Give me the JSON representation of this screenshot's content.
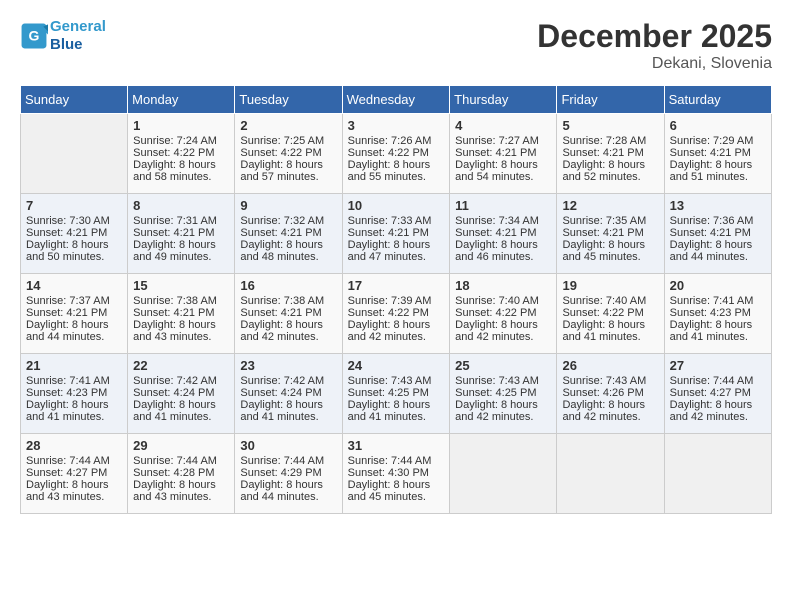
{
  "header": {
    "logo_line1": "General",
    "logo_line2": "Blue",
    "month": "December 2025",
    "location": "Dekani, Slovenia"
  },
  "weekdays": [
    "Sunday",
    "Monday",
    "Tuesday",
    "Wednesday",
    "Thursday",
    "Friday",
    "Saturday"
  ],
  "weeks": [
    [
      {
        "day": "",
        "empty": true,
        "lines": []
      },
      {
        "day": "1",
        "lines": [
          "Sunrise: 7:24 AM",
          "Sunset: 4:22 PM",
          "Daylight: 8 hours",
          "and 58 minutes."
        ]
      },
      {
        "day": "2",
        "lines": [
          "Sunrise: 7:25 AM",
          "Sunset: 4:22 PM",
          "Daylight: 8 hours",
          "and 57 minutes."
        ]
      },
      {
        "day": "3",
        "lines": [
          "Sunrise: 7:26 AM",
          "Sunset: 4:22 PM",
          "Daylight: 8 hours",
          "and 55 minutes."
        ]
      },
      {
        "day": "4",
        "lines": [
          "Sunrise: 7:27 AM",
          "Sunset: 4:21 PM",
          "Daylight: 8 hours",
          "and 54 minutes."
        ]
      },
      {
        "day": "5",
        "lines": [
          "Sunrise: 7:28 AM",
          "Sunset: 4:21 PM",
          "Daylight: 8 hours",
          "and 52 minutes."
        ]
      },
      {
        "day": "6",
        "lines": [
          "Sunrise: 7:29 AM",
          "Sunset: 4:21 PM",
          "Daylight: 8 hours",
          "and 51 minutes."
        ]
      }
    ],
    [
      {
        "day": "7",
        "lines": [
          "Sunrise: 7:30 AM",
          "Sunset: 4:21 PM",
          "Daylight: 8 hours",
          "and 50 minutes."
        ]
      },
      {
        "day": "8",
        "lines": [
          "Sunrise: 7:31 AM",
          "Sunset: 4:21 PM",
          "Daylight: 8 hours",
          "and 49 minutes."
        ]
      },
      {
        "day": "9",
        "lines": [
          "Sunrise: 7:32 AM",
          "Sunset: 4:21 PM",
          "Daylight: 8 hours",
          "and 48 minutes."
        ]
      },
      {
        "day": "10",
        "lines": [
          "Sunrise: 7:33 AM",
          "Sunset: 4:21 PM",
          "Daylight: 8 hours",
          "and 47 minutes."
        ]
      },
      {
        "day": "11",
        "lines": [
          "Sunrise: 7:34 AM",
          "Sunset: 4:21 PM",
          "Daylight: 8 hours",
          "and 46 minutes."
        ]
      },
      {
        "day": "12",
        "lines": [
          "Sunrise: 7:35 AM",
          "Sunset: 4:21 PM",
          "Daylight: 8 hours",
          "and 45 minutes."
        ]
      },
      {
        "day": "13",
        "lines": [
          "Sunrise: 7:36 AM",
          "Sunset: 4:21 PM",
          "Daylight: 8 hours",
          "and 44 minutes."
        ]
      }
    ],
    [
      {
        "day": "14",
        "lines": [
          "Sunrise: 7:37 AM",
          "Sunset: 4:21 PM",
          "Daylight: 8 hours",
          "and 44 minutes."
        ]
      },
      {
        "day": "15",
        "lines": [
          "Sunrise: 7:38 AM",
          "Sunset: 4:21 PM",
          "Daylight: 8 hours",
          "and 43 minutes."
        ]
      },
      {
        "day": "16",
        "lines": [
          "Sunrise: 7:38 AM",
          "Sunset: 4:21 PM",
          "Daylight: 8 hours",
          "and 42 minutes."
        ]
      },
      {
        "day": "17",
        "lines": [
          "Sunrise: 7:39 AM",
          "Sunset: 4:22 PM",
          "Daylight: 8 hours",
          "and 42 minutes."
        ]
      },
      {
        "day": "18",
        "lines": [
          "Sunrise: 7:40 AM",
          "Sunset: 4:22 PM",
          "Daylight: 8 hours",
          "and 42 minutes."
        ]
      },
      {
        "day": "19",
        "lines": [
          "Sunrise: 7:40 AM",
          "Sunset: 4:22 PM",
          "Daylight: 8 hours",
          "and 41 minutes."
        ]
      },
      {
        "day": "20",
        "lines": [
          "Sunrise: 7:41 AM",
          "Sunset: 4:23 PM",
          "Daylight: 8 hours",
          "and 41 minutes."
        ]
      }
    ],
    [
      {
        "day": "21",
        "lines": [
          "Sunrise: 7:41 AM",
          "Sunset: 4:23 PM",
          "Daylight: 8 hours",
          "and 41 minutes."
        ]
      },
      {
        "day": "22",
        "lines": [
          "Sunrise: 7:42 AM",
          "Sunset: 4:24 PM",
          "Daylight: 8 hours",
          "and 41 minutes."
        ]
      },
      {
        "day": "23",
        "lines": [
          "Sunrise: 7:42 AM",
          "Sunset: 4:24 PM",
          "Daylight: 8 hours",
          "and 41 minutes."
        ]
      },
      {
        "day": "24",
        "lines": [
          "Sunrise: 7:43 AM",
          "Sunset: 4:25 PM",
          "Daylight: 8 hours",
          "and 41 minutes."
        ]
      },
      {
        "day": "25",
        "lines": [
          "Sunrise: 7:43 AM",
          "Sunset: 4:25 PM",
          "Daylight: 8 hours",
          "and 42 minutes."
        ]
      },
      {
        "day": "26",
        "lines": [
          "Sunrise: 7:43 AM",
          "Sunset: 4:26 PM",
          "Daylight: 8 hours",
          "and 42 minutes."
        ]
      },
      {
        "day": "27",
        "lines": [
          "Sunrise: 7:44 AM",
          "Sunset: 4:27 PM",
          "Daylight: 8 hours",
          "and 42 minutes."
        ]
      }
    ],
    [
      {
        "day": "28",
        "lines": [
          "Sunrise: 7:44 AM",
          "Sunset: 4:27 PM",
          "Daylight: 8 hours",
          "and 43 minutes."
        ]
      },
      {
        "day": "29",
        "lines": [
          "Sunrise: 7:44 AM",
          "Sunset: 4:28 PM",
          "Daylight: 8 hours",
          "and 43 minutes."
        ]
      },
      {
        "day": "30",
        "lines": [
          "Sunrise: 7:44 AM",
          "Sunset: 4:29 PM",
          "Daylight: 8 hours",
          "and 44 minutes."
        ]
      },
      {
        "day": "31",
        "lines": [
          "Sunrise: 7:44 AM",
          "Sunset: 4:30 PM",
          "Daylight: 8 hours",
          "and 45 minutes."
        ]
      },
      {
        "day": "",
        "empty": true,
        "lines": []
      },
      {
        "day": "",
        "empty": true,
        "lines": []
      },
      {
        "day": "",
        "empty": true,
        "lines": []
      }
    ]
  ]
}
